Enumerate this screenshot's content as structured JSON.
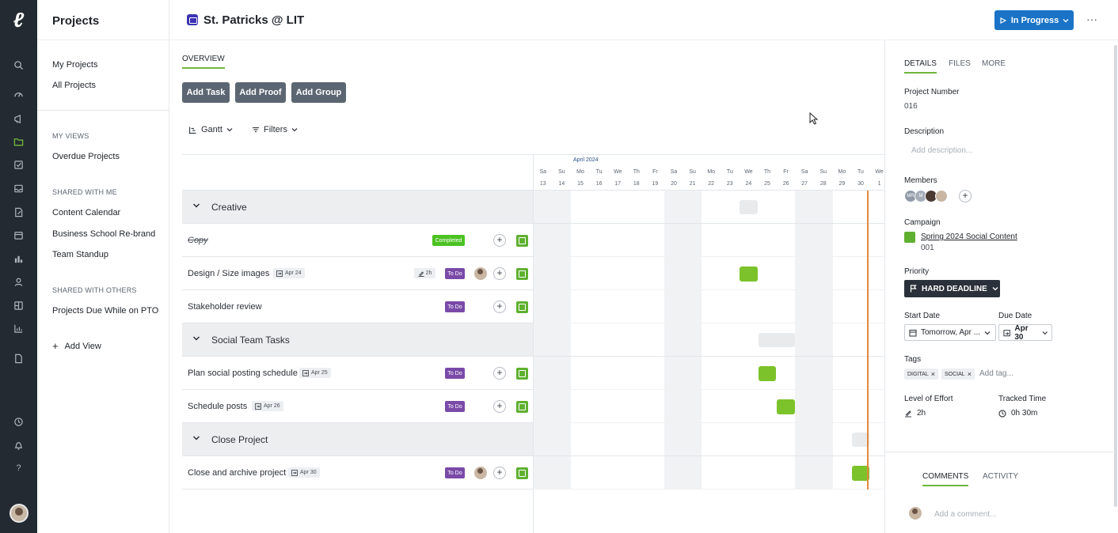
{
  "rail": {
    "logo": "ℓ",
    "icons": [
      "search-icon",
      "dashboard-icon",
      "campaign-icon",
      "projects-icon",
      "tasks-icon",
      "inbox-icon",
      "proofs-icon",
      "calendar-icon",
      "reports-icon",
      "people-icon",
      "board-icon",
      "analytics-icon",
      "files-icon",
      "timer-icon",
      "notifications-icon",
      "help-icon"
    ]
  },
  "nav": {
    "title": "Projects",
    "top_links": [
      "My Projects",
      "All Projects"
    ],
    "my_views_heading": "MY VIEWS",
    "my_views": [
      "Overdue Projects"
    ],
    "shared_with_me_heading": "SHARED WITH ME",
    "shared_with_me": [
      "Content Calendar",
      "Business School Re-brand",
      "Team Standup"
    ],
    "shared_with_others_heading": "SHARED WITH OTHERS",
    "shared_with_others": [
      "Projects Due While on PTO"
    ],
    "add_view": "Add View"
  },
  "header": {
    "project_title": "St. Patricks @ LIT",
    "status_label": "In Progress",
    "more_label": "···"
  },
  "main": {
    "tab_overview": "OVERVIEW",
    "buttons": {
      "add_task": "Add Task",
      "add_proof": "Add Proof",
      "add_group": "Add Group"
    },
    "view_label": "Gantt",
    "filters_label": "Filters"
  },
  "timeline": {
    "month": "April 2024",
    "days": [
      {
        "dow": "Sa",
        "d": "13",
        "weekend": true
      },
      {
        "dow": "Su",
        "d": "14",
        "weekend": true
      },
      {
        "dow": "Mo",
        "d": "15"
      },
      {
        "dow": "Tu",
        "d": "16"
      },
      {
        "dow": "We",
        "d": "17"
      },
      {
        "dow": "Th",
        "d": "18"
      },
      {
        "dow": "Fr",
        "d": "19"
      },
      {
        "dow": "Sa",
        "d": "20",
        "weekend": true
      },
      {
        "dow": "Su",
        "d": "21",
        "weekend": true
      },
      {
        "dow": "Mo",
        "d": "22"
      },
      {
        "dow": "Tu",
        "d": "23"
      },
      {
        "dow": "We",
        "d": "24"
      },
      {
        "dow": "Th",
        "d": "25"
      },
      {
        "dow": "Fr",
        "d": "26"
      },
      {
        "dow": "Sa",
        "d": "27",
        "weekend": true
      },
      {
        "dow": "Su",
        "d": "28",
        "weekend": true
      },
      {
        "dow": "Mo",
        "d": "29"
      },
      {
        "dow": "Tu",
        "d": "30"
      },
      {
        "dow": "We",
        "d": "1"
      }
    ]
  },
  "rows": [
    {
      "type": "group",
      "label": "Creative",
      "bar_days": [
        "24"
      ]
    },
    {
      "type": "task",
      "label": "Copy",
      "done": true,
      "status": "Completed",
      "status_kind": "completed",
      "date": "",
      "effort": "",
      "assignee": false,
      "bar_days": []
    },
    {
      "type": "task",
      "label": "Design / Size images",
      "done": false,
      "status": "To Do",
      "status_kind": "todo",
      "date": "Apr 24",
      "effort": "2h",
      "assignee": true,
      "bar_days": [
        "24"
      ]
    },
    {
      "type": "task",
      "label": "Stakeholder review",
      "done": false,
      "status": "To Do",
      "status_kind": "todo",
      "date": "",
      "effort": "",
      "assignee": false,
      "bar_days": []
    },
    {
      "type": "group",
      "label": "Social Team Tasks",
      "bar_days": [
        "25",
        "26"
      ]
    },
    {
      "type": "task",
      "label": "Plan social posting schedule",
      "done": false,
      "status": "To Do",
      "status_kind": "todo",
      "date": "Apr 25",
      "effort": "",
      "assignee": false,
      "bar_days": [
        "25"
      ]
    },
    {
      "type": "task",
      "label": "Schedule posts",
      "done": false,
      "status": "To Do",
      "status_kind": "todo",
      "date": "Apr 26",
      "effort": "",
      "assignee": false,
      "bar_days": [
        "26"
      ]
    },
    {
      "type": "group",
      "label": "Close Project",
      "bar_days": [
        "30"
      ]
    },
    {
      "type": "task",
      "label": "Close and archive project",
      "done": false,
      "status": "To Do",
      "status_kind": "todo",
      "date": "Apr 30",
      "effort": "",
      "assignee": true,
      "bar_days": [
        "30"
      ]
    }
  ],
  "details": {
    "tabs": {
      "details": "DETAILS",
      "files": "FILES",
      "more": "MORE"
    },
    "project_number_label": "Project Number",
    "project_number": "016",
    "description_label": "Description",
    "description_placeholder": "Add description...",
    "members_label": "Members",
    "members": [
      {
        "initials": "MR",
        "color": "#8f99a6"
      },
      {
        "initials": "M",
        "color": "#a4adb8"
      },
      {
        "initials": "",
        "color": "#4a3a32"
      },
      {
        "initials": "",
        "color": "#c9b7a4"
      }
    ],
    "campaign_label": "Campaign",
    "campaign_name": "Spring 2024 Social Content",
    "campaign_number": "001",
    "priority_label": "Priority",
    "priority_value": "HARD DEADLINE",
    "start_date_label": "Start Date",
    "start_date_value": "Tomorrow, Apr ...",
    "due_date_label": "Due Date",
    "due_date_value": "Apr 30",
    "tags_label": "Tags",
    "tags": [
      "DIGITAL",
      "SOCIAL"
    ],
    "add_tag_placeholder": "Add tag...",
    "effort_label": "Level of Effort",
    "effort_value": "2h",
    "tracked_label": "Tracked Time",
    "tracked_value": "0h 30m",
    "comments_tab": "COMMENTS",
    "activity_tab": "ACTIVITY",
    "comment_placeholder": "Add a comment..."
  },
  "colors": {
    "accent_green": "#6fb83a",
    "todo_purple": "#7a4aa8",
    "completed_green": "#4bc222",
    "status_blue": "#1a73c6",
    "today_orange": "#e2893d",
    "rail_dark": "#242a31"
  }
}
